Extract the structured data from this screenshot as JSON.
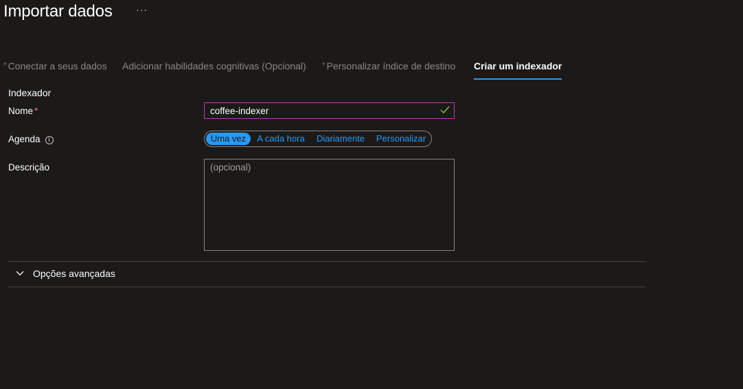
{
  "header": {
    "title": "Importar dados",
    "more_label": "···"
  },
  "tabs": [
    {
      "label": "Conectar a seus dados",
      "required_mark": "*"
    },
    {
      "label": "Adicionar habilidades cognitivas (Opcional)",
      "required_mark": ""
    },
    {
      "label": "Personalizar índice de destino",
      "required_mark": "*"
    },
    {
      "label": "Criar um indexador",
      "required_mark": "",
      "active": true
    }
  ],
  "form": {
    "section_title": "Indexador",
    "name": {
      "label": "Nome",
      "required_mark": "*",
      "value": "coffee-indexer",
      "valid": true
    },
    "schedule": {
      "label": "Agenda",
      "info_icon": "info-icon",
      "options": [
        "Uma vez",
        "A cada hora",
        "Diariamente",
        "Personalizar"
      ],
      "selected": "Uma vez"
    },
    "description": {
      "label": "Descrição",
      "placeholder": "(opcional)",
      "value": ""
    },
    "advanced": {
      "label": "Opções avançadas",
      "icon": "chevron-down-icon",
      "expanded": false
    }
  },
  "colors": {
    "background": "#1b1a19",
    "accent": "#2899f5",
    "input_focus_border": "#c239b3",
    "valid_check": "#92c353",
    "required_star": "#f1707b",
    "muted_text": "#8a8886"
  }
}
